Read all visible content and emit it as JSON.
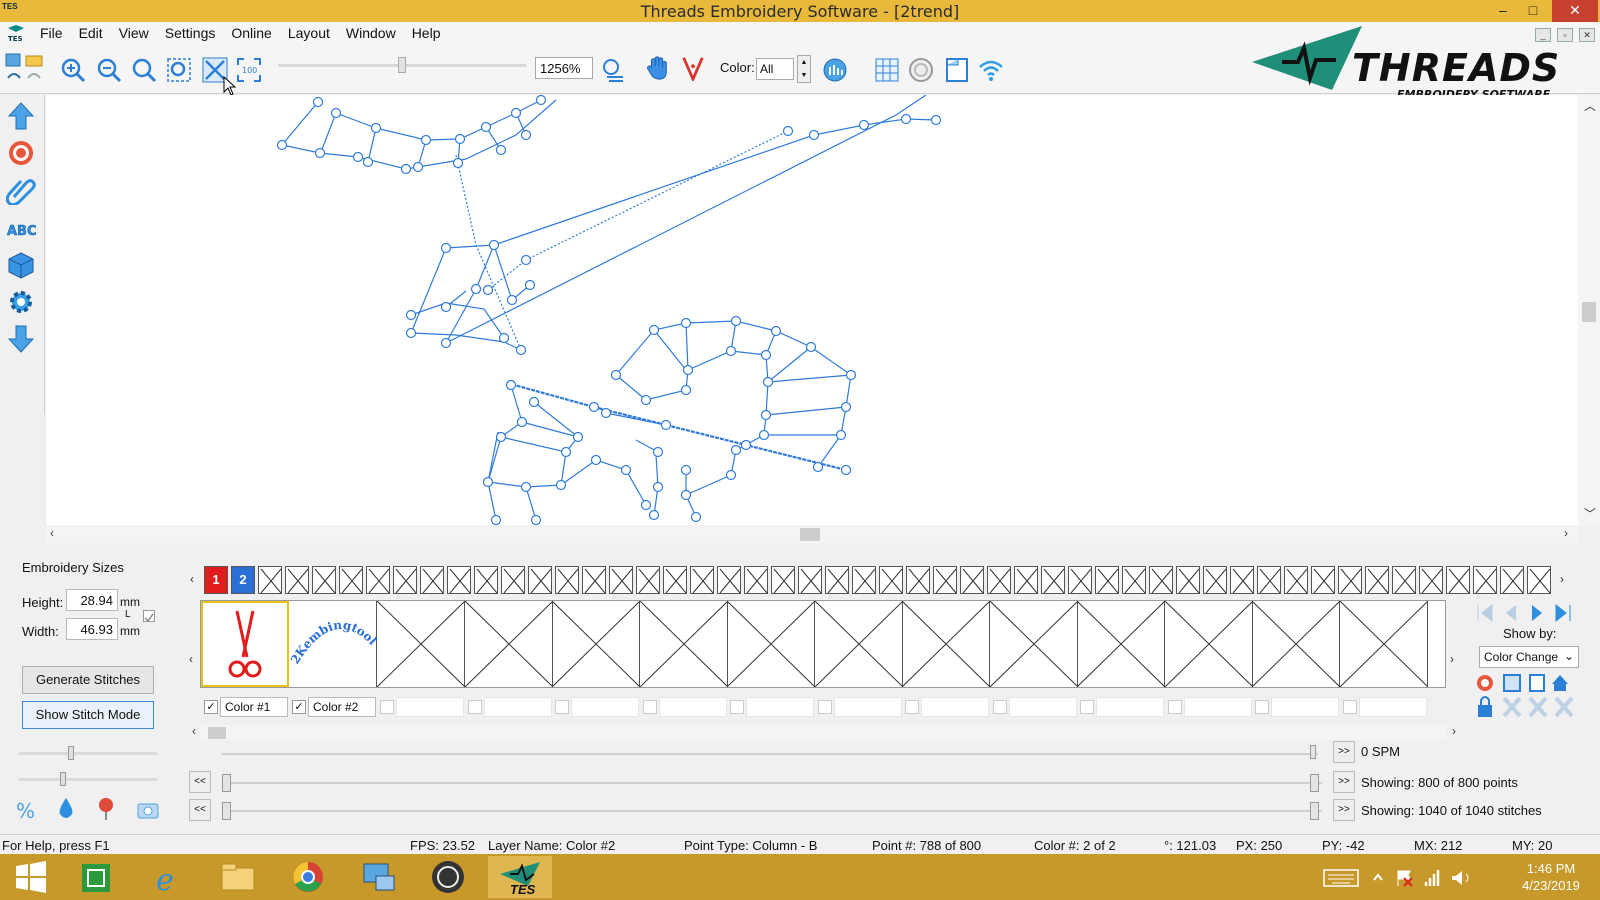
{
  "window": {
    "title": "Threads Embroidery Software - [2trend]",
    "app_icon_text": "TES",
    "minimize": "–",
    "maximize": "□",
    "close": "✕"
  },
  "menu": {
    "items": [
      "File",
      "Edit",
      "View",
      "Settings",
      "Online",
      "Layout",
      "Window",
      "Help"
    ],
    "mdi_controls": [
      "_",
      "▫",
      "✕"
    ]
  },
  "toolbar": {
    "zoom_value": "1256%",
    "color_label": "Color:",
    "color_value": "All",
    "icons": [
      "new-icon",
      "open-icon",
      "undo-icon",
      "redo-icon",
      "zoom-in-icon",
      "zoom-out-icon",
      "zoom-reset-icon",
      "zoom-select-icon",
      "zoom-fit-icon",
      "zoom-100-icon",
      "layers-icon",
      "hand-icon",
      "thread-cut-icon",
      "stats-icon",
      "grid-icon",
      "hoop-icon",
      "page-icon",
      "wifi-icon"
    ]
  },
  "logo": {
    "wordmark": "THREADS",
    "tagline": "EMBROIDERY SOFTWARE"
  },
  "left_tools": [
    "arrow-up-icon",
    "target-icon",
    "clip-icon",
    "abc-text-icon",
    "cube-icon",
    "gear-icon",
    "arrow-down-icon"
  ],
  "sizes_panel": {
    "title": "Embroidery Sizes",
    "height_label": "Height:",
    "height_value": "28.94",
    "width_label": "Width:",
    "width_value": "46.93",
    "unit": "mm",
    "lock_label": "L",
    "generate_button": "Generate Stitches",
    "stitch_mode_button": "Show Stitch Mode"
  },
  "color_strip": {
    "swatches": [
      "1",
      "2"
    ],
    "empty_count": 48
  },
  "thumbnails": {
    "items": [
      {
        "label": "Color #1",
        "checked": true,
        "selected": true
      },
      {
        "label": "Color #2",
        "checked": true,
        "selected": false
      }
    ],
    "empty_slots": 12,
    "thumb2_text": "2Kembingtools"
  },
  "right_panel": {
    "show_by_label": "Show by:",
    "show_by_value": "Color Change"
  },
  "playback": {
    "speed_text": "0 SPM",
    "points_text": "Showing: 800 of 800 points",
    "stitches_text": "Showing: 1040 of 1040 stitches",
    "back_label": "<<",
    "fwd_label": ">>"
  },
  "status": {
    "help": "For Help, press F1",
    "fps": "FPS: 23.52",
    "layer": "Layer Name: Color #2",
    "point_type": "Point Type: Column - B",
    "point_num": "Point #: 788 of 800",
    "color_num": "Color #: 2 of 2",
    "angle": "°: 121.03",
    "px": "PX: 250",
    "py": "PY: -42",
    "mx": "MX: 212",
    "my": "MY: 20"
  },
  "taskbar": {
    "time": "1:46 PM",
    "date": "4/23/2019",
    "tes_label": "TES"
  },
  "colors": {
    "title_bar": "#e8b93b",
    "taskbar": "#c7992a",
    "stitch_blue": "#2f7bdc",
    "swatch_red": "#e01c1c",
    "swatch_blue": "#2a6fd6"
  }
}
